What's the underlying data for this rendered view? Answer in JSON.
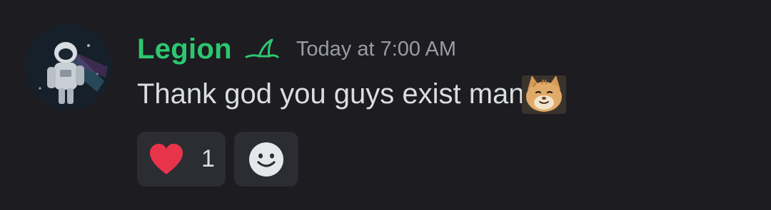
{
  "message": {
    "author": "Legion",
    "timestamp": "Today at 7:00 AM",
    "text": "Thank god you guys exist man",
    "avatar_icon": "astronaut-avatar",
    "badge_icon": "shark-fin-icon",
    "inline_emoji": "cat-emoji"
  },
  "reactions": [
    {
      "icon": "heart-icon",
      "count": "1"
    }
  ],
  "add_reaction": {
    "icon": "smile-icon"
  },
  "colors": {
    "background": "#1c1c21",
    "username": "#2dc770",
    "timestamp": "#9a9ca5",
    "text": "#dbdee1",
    "reaction_bg": "#2b2d33",
    "heart": "#e8344a"
  }
}
